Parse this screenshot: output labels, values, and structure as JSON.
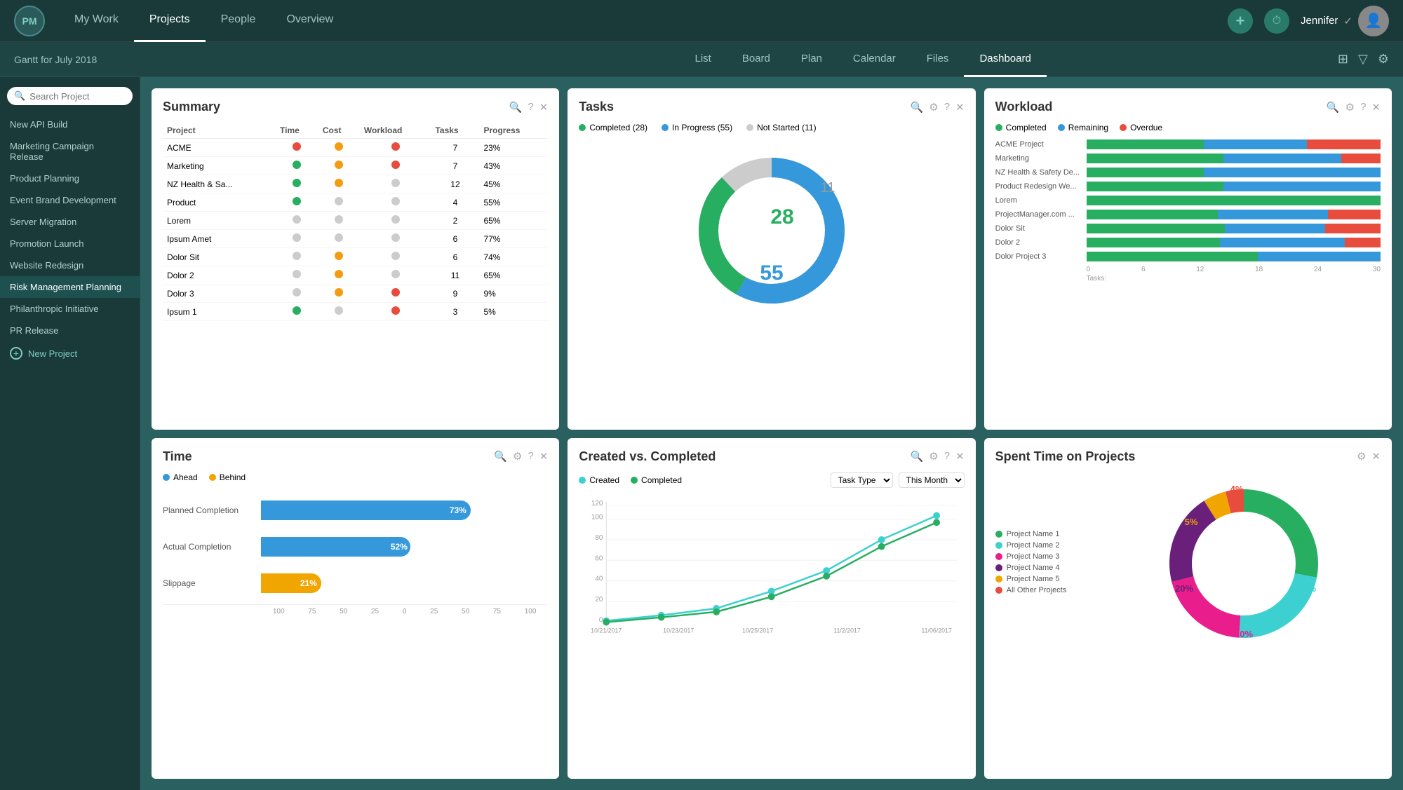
{
  "topNav": {
    "logo": "PM",
    "items": [
      {
        "label": "My Work",
        "active": false
      },
      {
        "label": "Projects",
        "active": true
      },
      {
        "label": "People",
        "active": false
      },
      {
        "label": "Overview",
        "active": false
      }
    ],
    "user": "Jennifer",
    "addIcon": "+",
    "clockIcon": "⏱"
  },
  "subNav": {
    "ganttLabel": "Gantt for July 2018",
    "tabs": [
      {
        "label": "List"
      },
      {
        "label": "Board"
      },
      {
        "label": "Plan"
      },
      {
        "label": "Calendar"
      },
      {
        "label": "Files"
      },
      {
        "label": "Dashboard",
        "active": true
      }
    ]
  },
  "sidebar": {
    "searchPlaceholder": "Search Project",
    "items": [
      {
        "label": "New API Build"
      },
      {
        "label": "Marketing Campaign Release"
      },
      {
        "label": "Product Planning"
      },
      {
        "label": "Event Brand Development"
      },
      {
        "label": "Server Migration"
      },
      {
        "label": "Promotion Launch"
      },
      {
        "label": "Website Redesign"
      },
      {
        "label": "Risk Management Planning",
        "active": true
      },
      {
        "label": "Philanthropic Initiative"
      },
      {
        "label": "PR Release"
      }
    ],
    "newProjectLabel": "New Project"
  },
  "summary": {
    "title": "Summary",
    "columns": [
      "Project",
      "Time",
      "Cost",
      "Workload",
      "Tasks",
      "Progress"
    ],
    "rows": [
      {
        "name": "ACME",
        "time": "red",
        "cost": "yellow",
        "workload": "red",
        "tasks": 7,
        "progress": "23%"
      },
      {
        "name": "Marketing",
        "time": "green",
        "cost": "yellow",
        "workload": "red",
        "tasks": 7,
        "progress": "43%"
      },
      {
        "name": "NZ Health & Sa...",
        "time": "green",
        "cost": "yellow",
        "workload": "gray",
        "tasks": 12,
        "progress": "45%"
      },
      {
        "name": "Product",
        "time": "green",
        "cost": "gray",
        "workload": "gray",
        "tasks": 4,
        "progress": "55%"
      },
      {
        "name": "Lorem",
        "time": "gray",
        "cost": "gray",
        "workload": "gray",
        "tasks": 2,
        "progress": "65%"
      },
      {
        "name": "Ipsum Amet",
        "time": "gray",
        "cost": "gray",
        "workload": "gray",
        "tasks": 6,
        "progress": "77%"
      },
      {
        "name": "Dolor Sit",
        "time": "gray",
        "cost": "yellow",
        "workload": "gray",
        "tasks": 6,
        "progress": "74%"
      },
      {
        "name": "Dolor 2",
        "time": "gray",
        "cost": "yellow",
        "workload": "gray",
        "tasks": 11,
        "progress": "65%"
      },
      {
        "name": "Dolor 3",
        "time": "gray",
        "cost": "yellow",
        "workload": "red",
        "tasks": 9,
        "progress": "9%"
      },
      {
        "name": "Ipsum 1",
        "time": "green",
        "cost": "gray",
        "workload": "red",
        "tasks": 3,
        "progress": "5%"
      }
    ]
  },
  "tasks": {
    "title": "Tasks",
    "legend": [
      {
        "label": "Completed (28)",
        "color": "#27ae60"
      },
      {
        "label": "In Progress (55)",
        "color": "#3498db"
      },
      {
        "label": "Not Started (11)",
        "color": "#ccc"
      }
    ],
    "completed": 28,
    "inProgress": 55,
    "notStarted": 11
  },
  "workload": {
    "title": "Workload",
    "legend": [
      {
        "label": "Completed",
        "color": "#27ae60"
      },
      {
        "label": "Remaining",
        "color": "#3498db"
      },
      {
        "label": "Overdue",
        "color": "#e74c3c"
      }
    ],
    "rows": [
      {
        "name": "ACME Project",
        "completed": 40,
        "remaining": 35,
        "overdue": 25
      },
      {
        "name": "Marketing",
        "completed": 35,
        "remaining": 30,
        "overdue": 10
      },
      {
        "name": "NZ Health & Safety De...",
        "completed": 30,
        "remaining": 45,
        "overdue": 0
      },
      {
        "name": "Product Redesign We...",
        "completed": 35,
        "remaining": 40,
        "overdue": 0
      },
      {
        "name": "Lorem",
        "completed": 75,
        "remaining": 0,
        "overdue": 0
      },
      {
        "name": "ProjectManager.com ...",
        "completed": 30,
        "remaining": 25,
        "overdue": 12
      },
      {
        "name": "Dolor Sit",
        "completed": 25,
        "remaining": 18,
        "overdue": 10
      },
      {
        "name": "Dolor 2",
        "completed": 30,
        "remaining": 28,
        "overdue": 8
      },
      {
        "name": "Dolor Project 3",
        "completed": 28,
        "remaining": 20,
        "overdue": 0
      }
    ],
    "axisLabels": [
      "0",
      "6",
      "12",
      "18",
      "24",
      "30"
    ]
  },
  "time": {
    "title": "Time",
    "legend": [
      {
        "label": "Ahead",
        "color": "#3498db"
      },
      {
        "label": "Behind",
        "color": "#f0a500"
      }
    ],
    "rows": [
      {
        "label": "Planned Completion",
        "type": "blue",
        "pct": 73,
        "pctLabel": "73%"
      },
      {
        "label": "Actual Completion",
        "type": "blue",
        "pct": 52,
        "pctLabel": "52%"
      },
      {
        "label": "Slippage",
        "type": "yellow",
        "pct": 21,
        "pctLabel": "21%"
      }
    ],
    "axisLabels": [
      "100",
      "75",
      "50",
      "25",
      "0",
      "25",
      "50",
      "75",
      "100"
    ]
  },
  "createdVsCompleted": {
    "title": "Created vs. Completed",
    "legend": [
      {
        "label": "Created",
        "color": "#3dd0d0"
      },
      {
        "label": "Completed",
        "color": "#27ae60"
      }
    ],
    "taskTypeLabel": "Task Type",
    "thisMonthLabel": "This Month",
    "yAxisLabels": [
      "0",
      "20",
      "40",
      "60",
      "80",
      "100",
      "120"
    ],
    "xAxisLabels": [
      "10/21/2017",
      "10/23/2017",
      "10/25/2017",
      "11/2/2017",
      "11/06/2017"
    ]
  },
  "spentTime": {
    "title": "Spent Time on Projects",
    "segments": [
      {
        "label": "Project Name 1",
        "color": "#27ae60",
        "pct": 28,
        "pctLabel": "28%"
      },
      {
        "label": "Project Name 2",
        "color": "#3dd0d0",
        "pctLabel": "23%",
        "pct": 23
      },
      {
        "label": "Project Name 3",
        "color": "#e91e8c",
        "pctLabel": "20%",
        "pct": 20
      },
      {
        "label": "Project Name 4",
        "color": "#6a1f7a",
        "pctLabel": "20%",
        "pct": 20
      },
      {
        "label": "Project Name 5",
        "color": "#f0a500",
        "pctLabel": "5%",
        "pct": 5
      },
      {
        "label": "All Other Projects",
        "color": "#e74c3c",
        "pctLabel": "4%",
        "pct": 4
      }
    ]
  }
}
